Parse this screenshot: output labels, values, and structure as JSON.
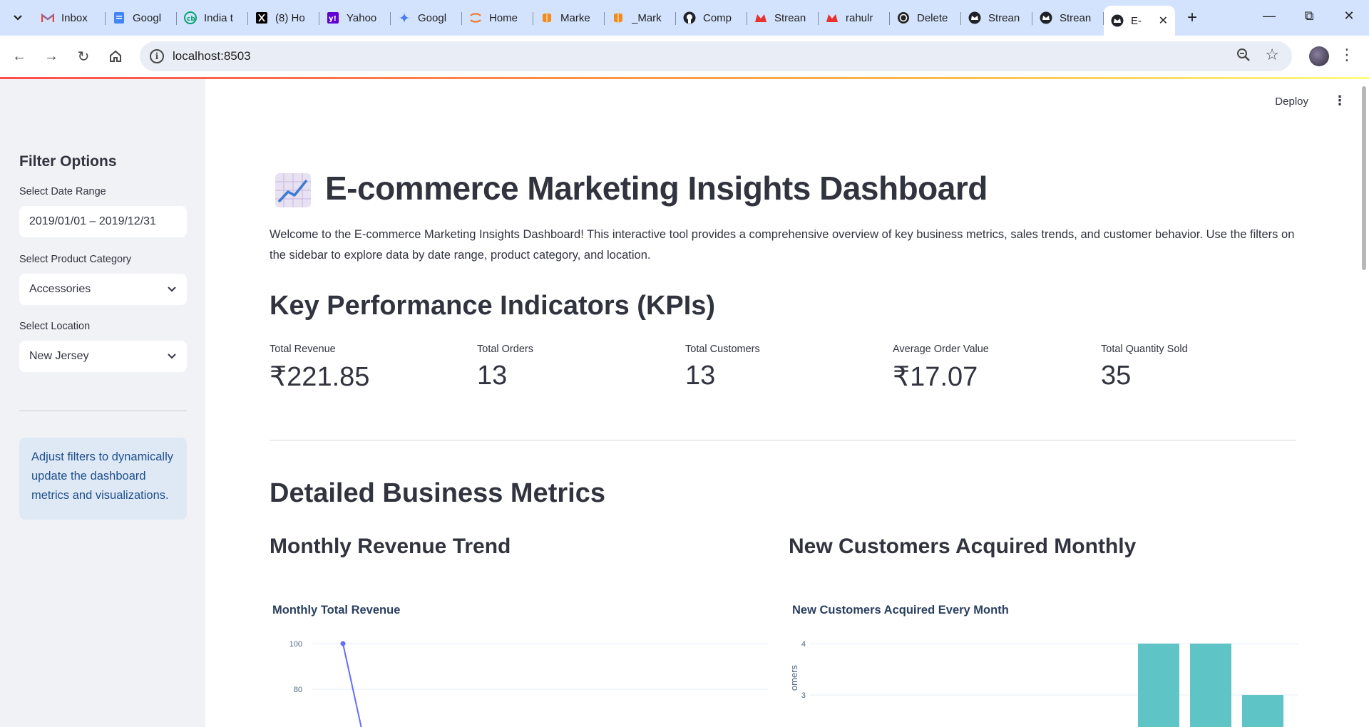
{
  "browser": {
    "tabs": [
      {
        "title": "Inbox",
        "icon": "gmail-icon"
      },
      {
        "title": "Googl",
        "icon": "google-docs-icon"
      },
      {
        "title": "India t",
        "icon": "cb-icon"
      },
      {
        "title": "(8) Ho",
        "icon": "x-icon"
      },
      {
        "title": "Yahoo",
        "icon": "yahoo-icon"
      },
      {
        "title": "Googl",
        "icon": "gemini-icon"
      },
      {
        "title": "Home",
        "icon": "jupyter-icon"
      },
      {
        "title": "Marke",
        "icon": "notebook-icon"
      },
      {
        "title": "_Mark",
        "icon": "notebook-icon"
      },
      {
        "title": "Comp",
        "icon": "github-icon"
      },
      {
        "title": "Strean",
        "icon": "streamlit-icon"
      },
      {
        "title": "rahulr",
        "icon": "streamlit-icon"
      },
      {
        "title": "Delete",
        "icon": "openai-icon"
      },
      {
        "title": "Strean",
        "icon": "streamlit-crown-icon"
      },
      {
        "title": "Strean",
        "icon": "streamlit-crown-icon"
      },
      {
        "title": "E-",
        "icon": "streamlit-crown-icon",
        "active": true
      }
    ],
    "url": "localhost:8503"
  },
  "sidebar": {
    "title": "Filter Options",
    "date_label": "Select Date Range",
    "date_value": "2019/01/01 – 2019/12/31",
    "category_label": "Select Product Category",
    "category_value": "Accessories",
    "location_label": "Select Location",
    "location_value": "New Jersey",
    "info_text": "Adjust filters to dynamically update the dashboard metrics and visualizations."
  },
  "header": {
    "deploy_label": "Deploy"
  },
  "main": {
    "title": "E-commerce Marketing Insights Dashboard",
    "intro": "Welcome to the E-commerce Marketing Insights Dashboard! This interactive tool provides a comprehensive overview of key business metrics, sales trends, and customer behavior. Use the filters on the sidebar to explore data by date range, product category, and location.",
    "kpi_heading": "Key Performance Indicators (KPIs)",
    "metrics": [
      {
        "label": "Total Revenue",
        "value": "₹221.85"
      },
      {
        "label": "Total Orders",
        "value": "13"
      },
      {
        "label": "Total Customers",
        "value": "13"
      },
      {
        "label": "Average Order Value",
        "value": "₹17.07"
      },
      {
        "label": "Total Quantity Sold",
        "value": "35"
      }
    ],
    "detail_heading": "Detailed Business Metrics",
    "revenue_subheading": "Monthly Revenue Trend",
    "customers_subheading": "New Customers Acquired Monthly"
  },
  "chart_data": [
    {
      "type": "line",
      "title": "Monthly Total Revenue",
      "y_ticks": [
        "100",
        "80"
      ],
      "ylim_visible": [
        80,
        100
      ],
      "points_visible": [
        {
          "y": 100
        }
      ],
      "color": "#636efa"
    },
    {
      "type": "bar",
      "title": "New Customers Acquired Every Month",
      "ylabel_partial": "omers",
      "y_ticks": [
        "4",
        "3"
      ],
      "values_visible": [
        4,
        4,
        3
      ],
      "color": "#5ec4c6"
    }
  ]
}
